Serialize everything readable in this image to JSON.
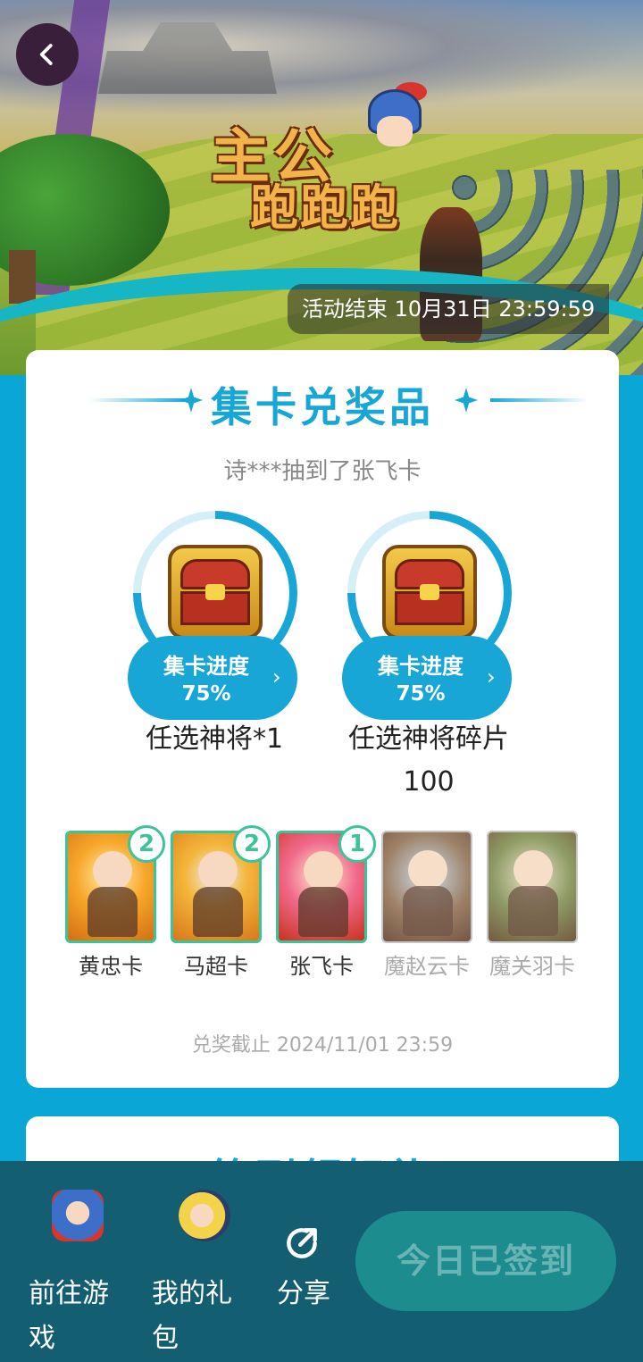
{
  "banner": {
    "title_line1": "主公",
    "title_line2": "跑跑跑",
    "event_end": "活动结束 10月31日 23:59:59"
  },
  "collect": {
    "title": "集卡兑奖品",
    "notice": "诗***抽到了张飞卡",
    "prizes": [
      {
        "progress_label": "集卡进度",
        "progress_value": "75%",
        "progress": 0.75,
        "name": "任选神将*1"
      },
      {
        "progress_label": "集卡进度",
        "progress_value": "75%",
        "progress": 0.75,
        "name": "任选神将碎片100"
      }
    ],
    "cards": [
      {
        "name": "黄忠卡",
        "count": "2"
      },
      {
        "name": "马超卡",
        "count": "2"
      },
      {
        "name": "张飞卡",
        "count": "1"
      },
      {
        "name": "魔赵云卡",
        "count": ""
      },
      {
        "name": "魔关羽卡",
        "count": ""
      }
    ],
    "deadline": "兑奖截止 2024/11/01 23:59"
  },
  "next_section": {
    "title": "签到领好礼"
  },
  "bottom_bar": {
    "go_game": "前往游戏",
    "my_gifts": "我的礼包",
    "share": "分享",
    "checkin": "今日已签到"
  },
  "colors": {
    "accent": "#18a6d6",
    "badge": "#3cc39a",
    "bottom_bg": "#145e72"
  },
  "icons": {
    "back": "chevron-left-icon",
    "share": "share-icon",
    "chest": "treasure-chest-icon"
  }
}
